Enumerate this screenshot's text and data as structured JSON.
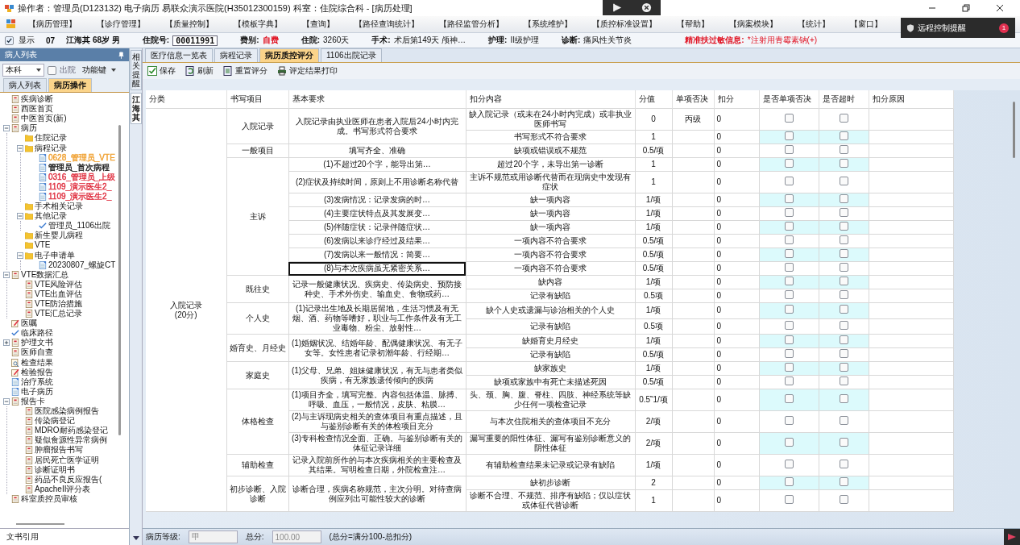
{
  "window": {
    "title": "操作者：管理员(D123132) 电子病历  易联众演示医院(H35012300159)  科室：住院综合科 - [病历处理]"
  },
  "notification": {
    "label": "远程控制提醒",
    "count": "1"
  },
  "menu": [
    "【病历管理】",
    "【诊疗管理】",
    "【质量控制】",
    "【模板字典】",
    "【查询】",
    "【路径查询统计】",
    "【路径监管分析】",
    "【系统维护】",
    "【质控标准设置】",
    "【帮助】",
    "【病案模块】",
    "【统计】",
    "【窗口】"
  ],
  "patient_bar": {
    "show": {
      "label": "显示",
      "checked": true
    },
    "bed": "07",
    "patient": "江海其 68岁 男",
    "fields": [
      {
        "label": "住院号:",
        "value": "00011991",
        "kind": "box"
      },
      {
        "label": "费别:",
        "value": "自费",
        "kind": "alert"
      },
      {
        "label": "住院:",
        "value": "3260天",
        "kind": "plain"
      },
      {
        "label": "手术:",
        "value": "术后第149天  颅神…",
        "kind": "plain"
      },
      {
        "label": "护理:",
        "value": "II级护理",
        "kind": "plain"
      },
      {
        "label": "诊断:",
        "value": "痛风性关节炎",
        "kind": "plain"
      }
    ],
    "allergy": {
      "label": "精准扶过敏信息:",
      "value": "*注射用青霉素钠(+)"
    }
  },
  "sidebar": {
    "title": "病人列表",
    "scope": "本科",
    "discharged": {
      "label": "出院",
      "checked": false
    },
    "function_key": "功能键",
    "tabs": [
      {
        "label": "病人列表",
        "selected": false
      },
      {
        "label": "病历操作",
        "selected": true
      }
    ],
    "tree": [
      {
        "label": "疾病诊断",
        "kind": "doc"
      },
      {
        "label": "西医首页",
        "kind": "doc"
      },
      {
        "label": "中医首页(新)",
        "kind": "doc"
      },
      {
        "label": "病历",
        "kind": "doc",
        "expanded": true,
        "children": [
          {
            "label": "住院记录",
            "kind": "folder"
          },
          {
            "label": "病程记录",
            "kind": "folder",
            "expanded": true,
            "children": [
              {
                "label": "0628_管理员_VTE",
                "kind": "sheet",
                "color": "#f0a030"
              },
              {
                "label": "管理员_首次病程",
                "kind": "sheet",
                "color": "#222222"
              },
              {
                "label": "0316_管理员_上级",
                "kind": "sheet",
                "color": "#e03040"
              },
              {
                "label": "1109_演示医生2_",
                "kind": "sheet",
                "color": "#e03040"
              },
              {
                "label": "1109_演示医生2_",
                "kind": "sheet",
                "color": "#e03040"
              }
            ]
          },
          {
            "label": "手术相关记录",
            "kind": "folder"
          },
          {
            "label": "其他记录",
            "kind": "folder",
            "expanded": true,
            "children": [
              {
                "label": "管理员_1106出院",
                "kind": "check"
              }
            ]
          },
          {
            "label": "新生婴儿病程",
            "kind": "folder"
          },
          {
            "label": "VTE",
            "kind": "folder"
          },
          {
            "label": "电子申请单",
            "kind": "folder",
            "expanded": true,
            "children": [
              {
                "label": "20230807_螺旋CT",
                "kind": "sheet"
              }
            ]
          }
        ]
      },
      {
        "label": "VTE数据汇总",
        "kind": "doc",
        "expanded": true,
        "children": [
          {
            "label": "VTE风险评估",
            "kind": "doc"
          },
          {
            "label": "VTE出血评估",
            "kind": "doc"
          },
          {
            "label": "VTE防治措施",
            "kind": "doc"
          },
          {
            "label": "VTE汇总记录",
            "kind": "doc"
          }
        ]
      },
      {
        "label": "医嘱",
        "kind": "edit"
      },
      {
        "label": "临床路径",
        "kind": "check"
      },
      {
        "label": "护理文书",
        "kind": "doc",
        "expanded": false
      },
      {
        "label": "医师自查",
        "kind": "doc"
      },
      {
        "label": "检查结果",
        "kind": "search"
      },
      {
        "label": "检验报告",
        "kind": "edit"
      },
      {
        "label": "治疗系统",
        "kind": "sheet"
      },
      {
        "label": "电子病历",
        "kind": "sheet"
      },
      {
        "label": "报告卡",
        "kind": "doc",
        "expanded": true,
        "children": [
          {
            "label": "医院感染病例报告",
            "kind": "doc"
          },
          {
            "label": "传染病登记",
            "kind": "doc"
          },
          {
            "label": "MDRO耐药感染登记",
            "kind": "doc"
          },
          {
            "label": "疑似食源性异常病例",
            "kind": "doc"
          },
          {
            "label": "肿瘤报告书写",
            "kind": "doc"
          },
          {
            "label": "居民死亡医学证明",
            "kind": "doc"
          },
          {
            "label": "诊断证明书",
            "kind": "doc"
          },
          {
            "label": "药品不良反应报告(",
            "kind": "doc"
          },
          {
            "label": "ApacheII评分表",
            "kind": "doc"
          }
        ]
      },
      {
        "label": "科室质控员审核",
        "kind": "doc"
      }
    ],
    "footer": "文书引用"
  },
  "side_tabs": [
    {
      "label": "相关提醒",
      "selected": false
    },
    {
      "label": "江海其",
      "selected": true
    }
  ],
  "main": {
    "tabs": [
      {
        "label": "医疗信息一览表",
        "selected": false
      },
      {
        "label": "病程记录",
        "selected": false
      },
      {
        "label": "病历质控评分",
        "selected": true
      },
      {
        "label": "1106出院记录",
        "selected": false
      }
    ],
    "toolbar": [
      {
        "label": "保存",
        "kind": "save"
      },
      {
        "label": "刷新",
        "kind": "refresh"
      },
      {
        "label": "重置评分",
        "kind": "reset"
      },
      {
        "label": "评定结果打印",
        "kind": "print"
      }
    ],
    "table": {
      "columns": [
        "分类",
        "书写项目",
        "基本要求",
        "扣分内容",
        "分值",
        "单项否决",
        "扣分",
        "是否单项否决",
        "是否超时",
        "扣分原因"
      ],
      "sections": [
        {
          "category": "入院记录",
          "points": "(20分)",
          "items": [
            {
              "item": "入院记录",
              "requirements": [
                {
                  "text": "入院记录由执业医师在患者入院后24小时内完成。书写形式符合要求",
                  "selected": false,
                  "deductions": [
                    {
                      "content": "缺入院记录（或未在24小时内完成）或非执业医师书写",
                      "score": "0",
                      "veto": "丙级",
                      "deduct": "0",
                      "single_veto": false,
                      "overtime": false
                    },
                    {
                      "content": "书写形式不符合要求",
                      "score": "1",
                      "deduct": "0",
                      "single_veto": false,
                      "overtime": false
                    }
                  ]
                }
              ]
            },
            {
              "item": "一般项目",
              "requirements": [
                {
                  "text": "填写齐全、准确",
                  "selected": false,
                  "deductions": [
                    {
                      "content": "缺项或错误或不规范",
                      "score": "0.5/项",
                      "deduct": "0",
                      "single_veto": false,
                      "overtime": false
                    }
                  ]
                }
              ]
            },
            {
              "item": "主诉",
              "requirements": [
                {
                  "text": "(1)不超过20个字，能导出第…",
                  "selected": false,
                  "deductions": [
                    {
                      "content": "超过20个字，未导出第一诊断",
                      "score": "1",
                      "deduct": "0",
                      "single_veto": false,
                      "overtime": false
                    }
                  ]
                },
                {
                  "text": "(2)症状及持续时间，原则上不用诊断名称代替",
                  "selected": false,
                  "deductions": [
                    {
                      "content": "主诉不规范或用诊断代替而在现病史中发现有症状",
                      "score": "1",
                      "deduct": "0",
                      "single_veto": false,
                      "overtime": false
                    }
                  ]
                },
                {
                  "text": "(3)发病情况：记录发病的时…",
                  "selected": false,
                  "deductions": [
                    {
                      "content": "缺一项内容",
                      "score": "1/项",
                      "deduct": "0",
                      "single_veto": false,
                      "overtime": false
                    }
                  ]
                },
                {
                  "text": "(4)主要症状特点及其发展变…",
                  "selected": false,
                  "deductions": [
                    {
                      "content": "缺一项内容",
                      "score": "1/项",
                      "deduct": "0",
                      "single_veto": false,
                      "overtime": false
                    }
                  ]
                },
                {
                  "text": "(5)伴随症状：记录伴随症状…",
                  "selected": false,
                  "deductions": [
                    {
                      "content": "缺一项内容",
                      "score": "1/项",
                      "deduct": "0",
                      "single_veto": false,
                      "overtime": false
                    }
                  ]
                },
                {
                  "text": "(6)发病以来诊疗经过及结果…",
                  "selected": false,
                  "deductions": [
                    {
                      "content": "一项内容不符合要求",
                      "score": "0.5/项",
                      "deduct": "0",
                      "single_veto": false,
                      "overtime": false
                    }
                  ]
                },
                {
                  "text": "(7)发病以来一般情况：简要…",
                  "selected": false,
                  "deductions": [
                    {
                      "content": "一项内容不符合要求",
                      "score": "0.5/项",
                      "deduct": "0",
                      "single_veto": false,
                      "overtime": false
                    }
                  ]
                },
                {
                  "text": "(8)与本次疾病虽无紧密关系…",
                  "selected": true,
                  "deductions": [
                    {
                      "content": "一项内容不符合要求",
                      "score": "0.5/项",
                      "deduct": "0",
                      "single_veto": false,
                      "overtime": false
                    }
                  ]
                }
              ]
            },
            {
              "item": "既往史",
              "requirements": [
                {
                  "text": "记录一般健康状况、疾病史、传染病史、预防接种史、手术外伤史、输血史、食物或药…",
                  "selected": false,
                  "deductions": [
                    {
                      "content": "缺内容",
                      "score": "1/项",
                      "deduct": "0",
                      "single_veto": false,
                      "overtime": false
                    },
                    {
                      "content": "记录有缺陷",
                      "score": "0.5项",
                      "deduct": "0",
                      "single_veto": false,
                      "overtime": false
                    }
                  ]
                }
              ]
            },
            {
              "item": "个人史",
              "requirements": [
                {
                  "text": "(1)记录出生地及长期居留地，生活习惯及有无烟、酒、药物等嗜好，职业与工作条件及有无工业毒物、粉尘、放射性…",
                  "selected": false,
                  "deductions": [
                    {
                      "content": "缺个人史或遗漏与诊治相关的个人史",
                      "score": "1/项",
                      "deduct": "0",
                      "single_veto": false,
                      "overtime": false
                    },
                    {
                      "content": "记录有缺陷",
                      "score": "0.5项",
                      "deduct": "0",
                      "single_veto": false,
                      "overtime": false
                    }
                  ]
                }
              ]
            },
            {
              "item": "婚育史、月经史",
              "requirements": [
                {
                  "text": "(1)婚姻状况、结婚年龄、配偶健康状况、有无子女等。女性患者记录初潮年龄、行经期…",
                  "selected": false,
                  "deductions": [
                    {
                      "content": "缺婚育史月经史",
                      "score": "1/项",
                      "deduct": "0",
                      "single_veto": false,
                      "overtime": false
                    },
                    {
                      "content": "记录有缺陷",
                      "score": "0.5/项",
                      "deduct": "0",
                      "single_veto": false,
                      "overtime": false
                    }
                  ]
                }
              ]
            },
            {
              "item": "家庭史",
              "requirements": [
                {
                  "text": "(1)父母、兄弟、姐妹健康状况，有无与患者类似疾病，有无家族遗传倾向的疾病",
                  "selected": false,
                  "deductions": [
                    {
                      "content": "缺家族史",
                      "score": "1/项",
                      "deduct": "0",
                      "single_veto": false,
                      "overtime": false
                    },
                    {
                      "content": "缺项或家族中有死亡未描述死因",
                      "score": "0.5/项",
                      "deduct": "0",
                      "single_veto": false,
                      "overtime": false
                    }
                  ]
                }
              ]
            },
            {
              "item": "体格检查",
              "requirements": [
                {
                  "text": "(1)项目齐全，填写完整。内容包括体温、脉搏、呼吸、血压，一般情况，皮肤、粘膜…",
                  "selected": false,
                  "deductions": [
                    {
                      "content": "头、颈、胸、腹、脊柱、四肢、神经系统等缺少任何一项检查记录",
                      "score": "0.5˜1/项",
                      "deduct": "0",
                      "single_veto": false,
                      "overtime": false
                    }
                  ]
                },
                {
                  "text": "(2)与主诉现病史相关的查体项目有重点描述，且与鉴别诊断有关的体检项目充分",
                  "selected": false,
                  "deductions": [
                    {
                      "content": "与本次住院相关的查体项目不充分",
                      "score": "2/项",
                      "deduct": "0",
                      "single_veto": false,
                      "overtime": false
                    }
                  ]
                },
                {
                  "text": "(3)专科检查情况全面、正确。与鉴别诊断有关的体征记录详细",
                  "selected": false,
                  "deductions": [
                    {
                      "content": "漏写重要的阳性体征、漏写有鉴别诊断意义的阴性体征",
                      "score": "2/项",
                      "deduct": "0",
                      "single_veto": false,
                      "overtime": false
                    }
                  ]
                }
              ]
            },
            {
              "item": "辅助检查",
              "requirements": [
                {
                  "text": "记录入院前所作的与本次疾病相关的主要检查及其结果。写明检查日期，外院检查注…",
                  "selected": false,
                  "deductions": [
                    {
                      "content": "有辅助检查结果未记录或记录有缺陷",
                      "score": "1/项",
                      "deduct": "0",
                      "single_veto": false,
                      "overtime": false
                    }
                  ]
                }
              ]
            },
            {
              "item": "初步诊断、入院诊断",
              "requirements": [
                {
                  "text": "诊断合理，疾病名称规范，主次分明。对待查病例应列出可能性较大的诊断",
                  "selected": false,
                  "deductions": [
                    {
                      "content": "缺初步诊断",
                      "score": "2",
                      "deduct": "0",
                      "single_veto": false,
                      "overtime": false
                    },
                    {
                      "content": "诊断不合理、不规范、排序有缺陷；仅以症状或体征代替诊断",
                      "score": "1",
                      "deduct": "0",
                      "single_veto": false,
                      "overtime": false
                    }
                  ]
                }
              ]
            }
          ]
        }
      ]
    },
    "footer": {
      "grade_label": "病历等级:",
      "grade": "甲",
      "total_label": "总分:",
      "total": "100.00",
      "formula": "(总分=满分100-总扣分)"
    }
  }
}
